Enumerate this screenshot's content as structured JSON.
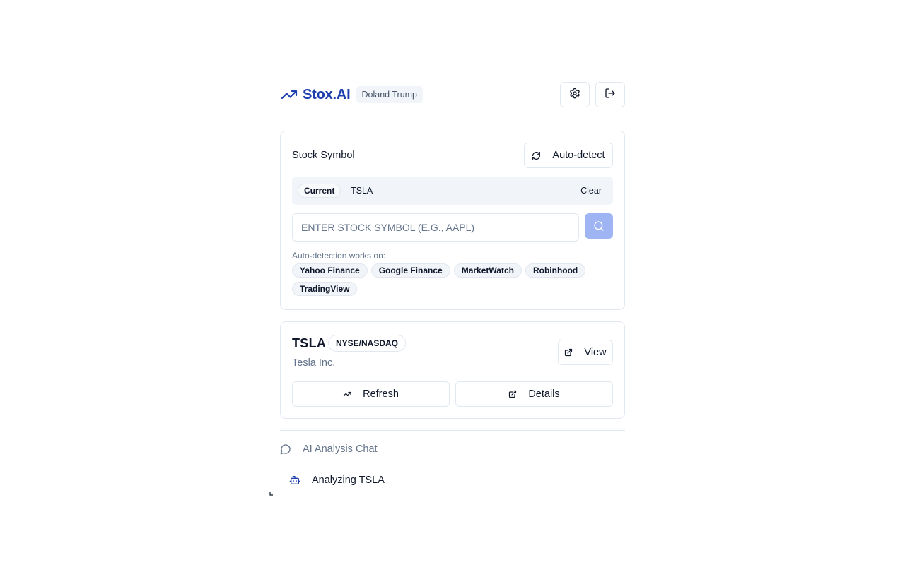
{
  "header": {
    "brand_name": "Stox.AI",
    "user_name": "Doland Trump",
    "icons": {
      "brand": "trending-up-icon",
      "settings": "gear-icon",
      "logout": "log-out-icon"
    }
  },
  "symbol_panel": {
    "title": "Stock Symbol",
    "autodetect_label": "Auto-detect",
    "current_label": "Current",
    "current_value": "TSLA",
    "clear_label": "Clear",
    "input_placeholder": "ENTER STOCK SYMBOL (E.G., AAPL)",
    "input_value": "",
    "sites_label": "Auto-detection works on:",
    "sites": [
      "Yahoo Finance",
      "Google Finance",
      "MarketWatch",
      "Robinhood",
      "TradingView"
    ]
  },
  "stock_card": {
    "ticker": "TSLA",
    "exchange": "NYSE/NASDAQ",
    "company": "Tesla Inc.",
    "view_label": "View",
    "refresh_label": "Refresh",
    "details_label": "Details"
  },
  "chat": {
    "title": "AI Analysis Chat",
    "status": "Analyzing TSLA"
  },
  "colors": {
    "brand": "#1e40af",
    "search_button": "#9fb4f3",
    "muted_text": "#64748b",
    "border": "#e2e8f0",
    "chip_bg": "#f1f5f9"
  }
}
